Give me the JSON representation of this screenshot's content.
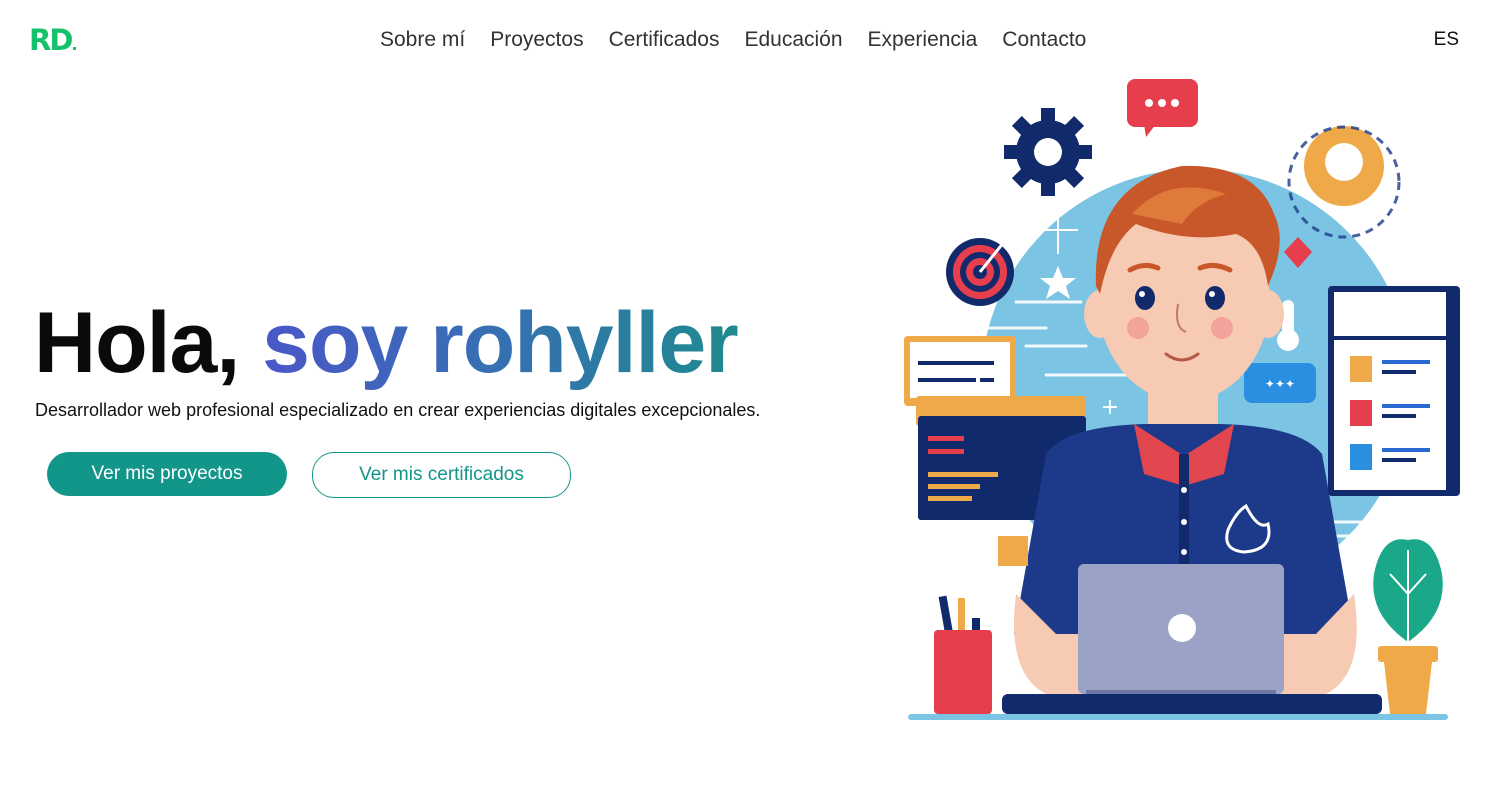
{
  "logo": {
    "text": "RD"
  },
  "nav": {
    "links": [
      "Sobre mí",
      "Proyectos",
      "Certificados",
      "Educación",
      "Experiencia",
      "Contacto"
    ],
    "language": "ES"
  },
  "hero": {
    "greeting": "Hola,",
    "name": "soy rohyller",
    "subtitle": "Desarrollador web profesional especializado en crear experiencias digitales excepcionales.",
    "primary_button": "Ver mis proyectos",
    "secondary_button": "Ver mis certificados"
  },
  "illustration": {
    "icons": [
      "gear-icon",
      "chat-bubble-icon",
      "location-pin-icon",
      "target-icon",
      "star-icon",
      "code-window-icon",
      "document-icon",
      "laptop-icon",
      "plant-icon",
      "pencil-cup-icon"
    ],
    "colors": {
      "circle": "#7cc4e4",
      "shirt": "#1d3a8a",
      "collar": "#e2474f",
      "hair": "#c8572a",
      "skin": "#f7cbb3",
      "laptop": "#9aa3c6",
      "accent_orange": "#f0a948",
      "accent_red": "#e63e4c",
      "accent_teal": "#1aa889"
    }
  }
}
